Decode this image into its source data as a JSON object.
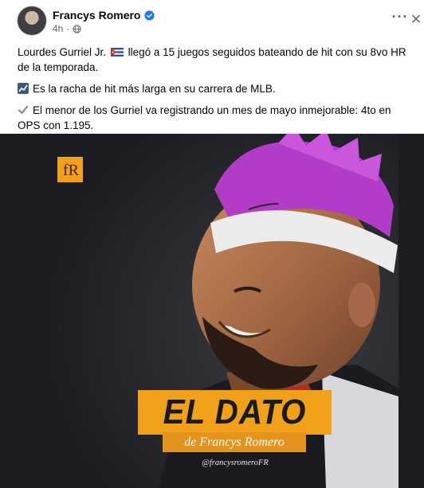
{
  "post": {
    "author": "Francys Romero",
    "time": "4h",
    "more_label": "···",
    "close_label": "×",
    "paragraphs": {
      "p1_a": "Lourdes Gurriel Jr.",
      "p1_flag_icon": "cuba-flag-icon",
      "p1_b": "llegó a 15 juegos seguidos bateando de hit con su 8vo HR de la temporada.",
      "p2_icon": "chart-icon",
      "p2": "Es la racha de hit más larga en su carrera de MLB.",
      "p3_icon": "check-icon",
      "p3": "El menor de los Gurriel va registrando un mes de mayo inmejorable: 4to en OPS con 1.195."
    }
  },
  "graphic": {
    "logo": "fR",
    "title": "EL DATO",
    "subtitle": "de Francys Romero",
    "handle": "@francysromeroFR"
  },
  "colors": {
    "accent_orange": "#f0a119",
    "hair_purple": "#b23cc7",
    "verified_blue": "#1877f2"
  }
}
